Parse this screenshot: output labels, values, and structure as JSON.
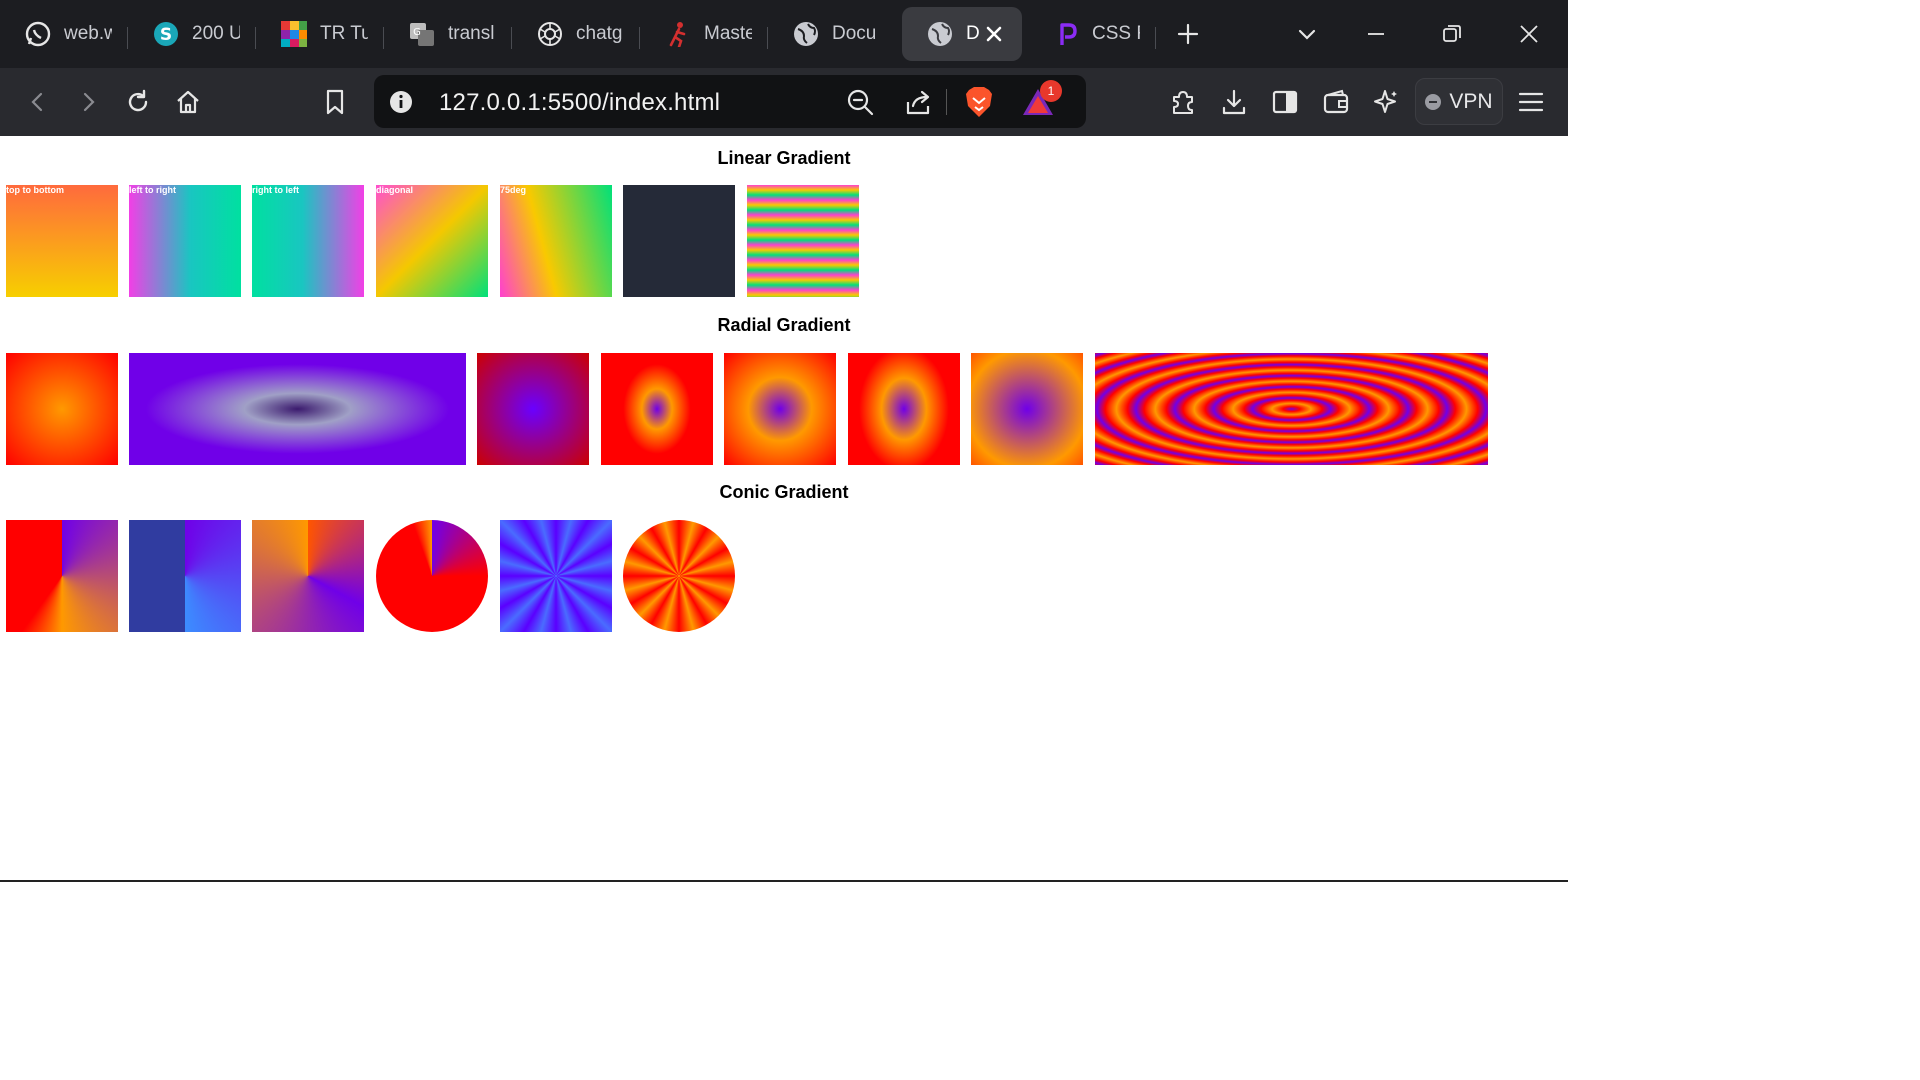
{
  "browser": {
    "tabs": [
      {
        "title": "web.w",
        "icon": "whatsapp-icon"
      },
      {
        "title": "200 U",
        "icon": "letter-s-icon"
      },
      {
        "title": "TR Tur",
        "icon": "tr-icon"
      },
      {
        "title": "transl",
        "icon": "translate-icon"
      },
      {
        "title": "chatg",
        "icon": "openai-icon"
      },
      {
        "title": "Maste",
        "icon": "runner-icon"
      },
      {
        "title": "Docu",
        "icon": "globe-icon"
      },
      {
        "title": "D",
        "icon": "globe-icon",
        "active": true
      },
      {
        "title": "CSS R",
        "icon": "p-logo-icon"
      }
    ],
    "address": "127.0.0.1:5500/index.html",
    "notification_count": "1",
    "vpn_label": "VPN"
  },
  "page": {
    "sections": [
      {
        "title": "Linear Gradient",
        "labels": [
          "top to bottom",
          "left to right",
          "right to left",
          "diagonal",
          "75deg"
        ]
      },
      {
        "title": "Radial Gradient"
      },
      {
        "title": "Conic Gradient"
      }
    ]
  },
  "colors": {
    "tabstrip_bg": "#1c1d21",
    "toolbar_bg": "#292a2f",
    "urlbar_bg": "#111214",
    "accent_red": "#ff0000",
    "accent_orange": "#ff9900",
    "accent_purple": "#7000e8"
  }
}
